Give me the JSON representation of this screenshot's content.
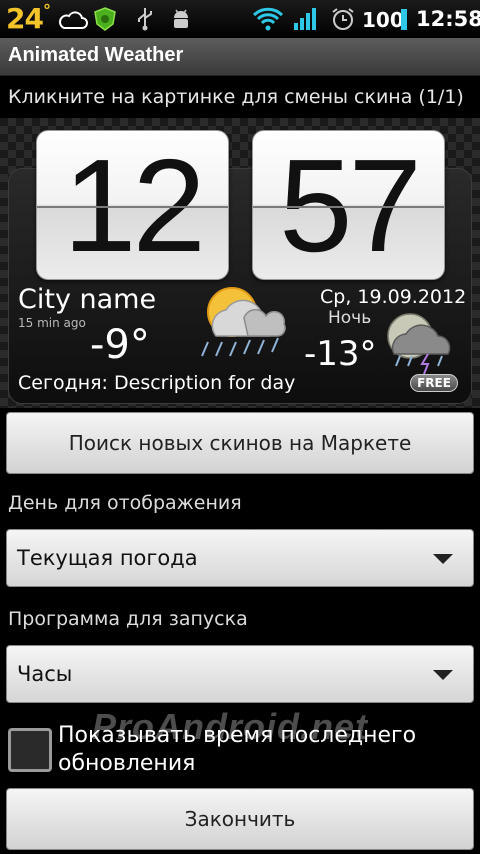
{
  "status_bar": {
    "temperature": "24",
    "degree": "°",
    "battery": "100",
    "time": "12:58",
    "icons": [
      "cloud-icon",
      "shield-icon",
      "usb-icon",
      "android-debug-icon",
      "wifi-icon",
      "signal-icon",
      "alarm-icon",
      "battery-icon"
    ]
  },
  "app": {
    "title": "Animated Weather"
  },
  "skin_hint": "Кликните на картинке для смены скина (1/1)",
  "widget": {
    "hour": "12",
    "minute": "57",
    "city": "City name",
    "updated": "15 min ago",
    "temp_now": "-9°",
    "date": "Ср, 19.09.2012",
    "night_label": "Ночь",
    "temp_night": "-13°",
    "today": "Сегодня: Description for day",
    "badge": "FREE",
    "icons": [
      "sun-rain-icon",
      "night-storm-icon"
    ]
  },
  "buttons": {
    "search_skins": "Поиск новых скинов на Маркете",
    "finish": "Закончить"
  },
  "day_setting": {
    "label": "День для отображения",
    "value": "Текущая погода"
  },
  "launch_setting": {
    "label": "Программа для запуска",
    "value": "Часы"
  },
  "show_update_time": {
    "label": "Показывать время последнего обновления",
    "checked": false
  },
  "watermark": "ProAndroid.net",
  "colors": {
    "status_temp": "#f2c42a",
    "battery": "#2ec8e6",
    "wifi": "#2ec8e6"
  }
}
